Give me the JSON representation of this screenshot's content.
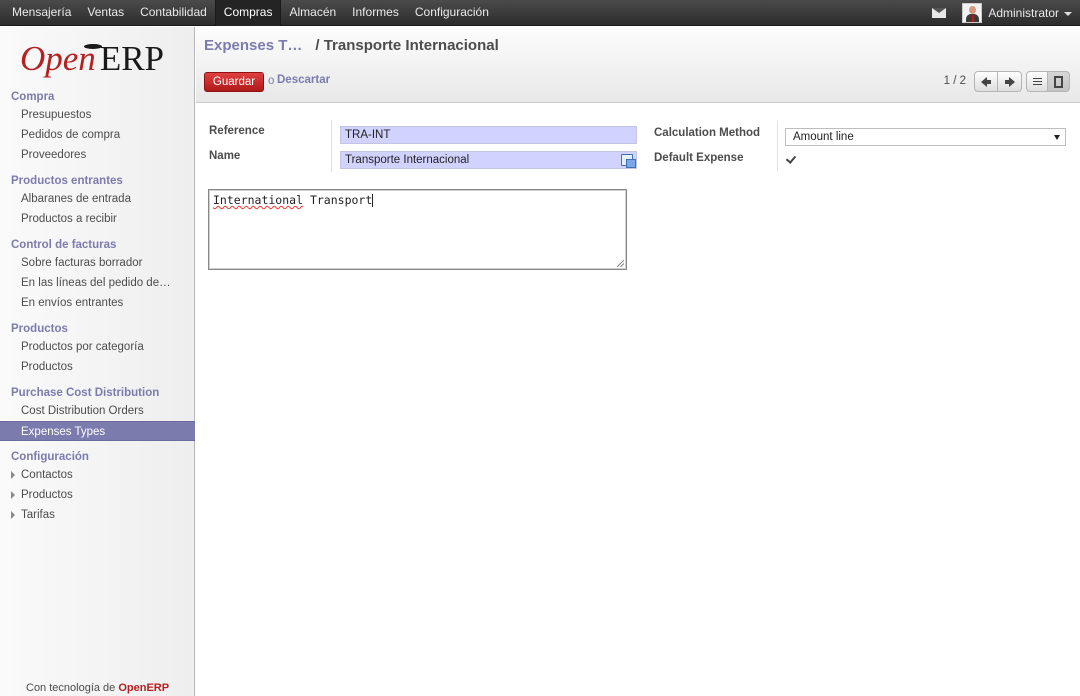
{
  "topbar": {
    "menu": [
      "Mensajería",
      "Ventas",
      "Contabilidad",
      "Compras",
      "Almacén",
      "Informes",
      "Configuración"
    ],
    "active": "Compras",
    "user": "Administrator"
  },
  "sidebar": {
    "logo_open": "Open",
    "logo_erp": "ERP",
    "sections": [
      {
        "title": "Compra",
        "items": [
          "Presupuestos",
          "Pedidos de compra",
          "Proveedores"
        ]
      },
      {
        "title": "Productos entrantes",
        "items": [
          "Albaranes de entrada",
          "Productos a recibir"
        ]
      },
      {
        "title": "Control de facturas",
        "items": [
          "Sobre facturas borrador",
          "En las líneas del pedido de…",
          "En envíos entrantes"
        ]
      },
      {
        "title": "Productos",
        "items": [
          "Productos por categoría",
          "Productos"
        ]
      },
      {
        "title": "Purchase Cost Distribution",
        "items": [
          "Cost Distribution Orders",
          "Expenses Types"
        ]
      },
      {
        "title": "Configuración",
        "items": [
          "Contactos",
          "Productos",
          "Tarifas"
        ]
      }
    ],
    "active_item": "Expenses Types",
    "footer_prefix": "Con tecnología de",
    "footer_brand": "OpenERP"
  },
  "header": {
    "breadcrumb_parent": "Expenses T…",
    "breadcrumb_sep": "/",
    "breadcrumb_current": "Transporte Internacional",
    "save_label": "Guardar",
    "or_label": "o",
    "discard_label": "Descartar",
    "pager": "1 / 2"
  },
  "form": {
    "reference_label": "Reference",
    "reference_value": "TRA-INT",
    "name_label": "Name",
    "name_value": "Transporte Internacional",
    "calc_method_label": "Calculation Method",
    "calc_method_value": "Amount line",
    "default_expense_label": "Default Expense",
    "default_expense_checked": true,
    "note_word1": "International",
    "note_word2": "Transport"
  }
}
